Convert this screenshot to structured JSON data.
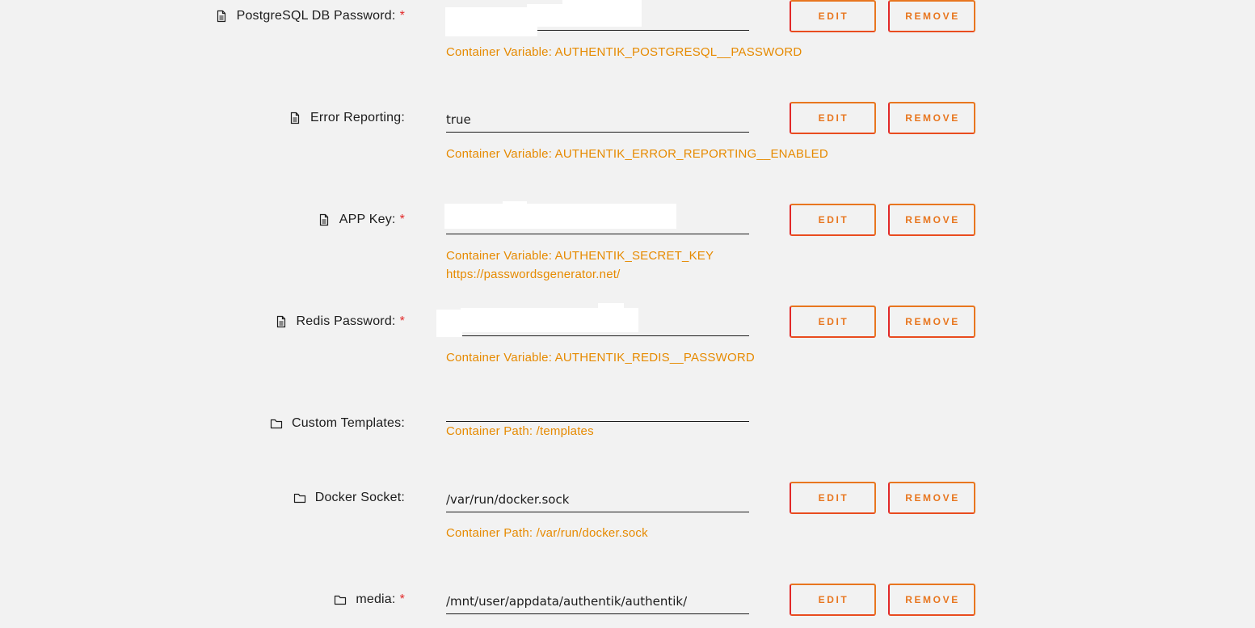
{
  "labels": {
    "edit": "EDIT",
    "remove": "REMOVE",
    "required_mark": "*"
  },
  "colors": {
    "accent_orange": "#e68a00",
    "button_border_red": "#e22828",
    "required_red": "#e22828"
  },
  "settings": [
    {
      "icon": "file-icon",
      "label": "PostgreSQL DB Password:",
      "required": true,
      "value": "",
      "value_masked": true,
      "description": "Container Variable: AUTHENTIK_POSTGRESQL__PASSWORD",
      "has_buttons": true
    },
    {
      "icon": "file-icon",
      "label": "Error Reporting:",
      "required": false,
      "value": "true",
      "description": "Container Variable: AUTHENTIK_ERROR_REPORTING__ENABLED",
      "has_buttons": true
    },
    {
      "icon": "file-icon",
      "label": "APP Key:",
      "required": true,
      "value": "",
      "value_masked": true,
      "description": "Container Variable: AUTHENTIK_SECRET_KEY",
      "description_extra": "https://passwordsgenerator.net/",
      "has_buttons": true
    },
    {
      "icon": "file-icon",
      "label": "Redis Password:",
      "required": true,
      "value": "",
      "value_masked": true,
      "description": "Container Variable: AUTHENTIK_REDIS__PASSWORD",
      "has_buttons": true
    },
    {
      "icon": "folder-icon",
      "label": "Custom Templates:",
      "required": false,
      "value": "",
      "description": "Container Path: /templates",
      "has_buttons": false
    },
    {
      "icon": "folder-icon",
      "label": "Docker Socket:",
      "required": false,
      "value": "/var/run/docker.sock",
      "description": "Container Path: /var/run/docker.sock",
      "has_buttons": true
    },
    {
      "icon": "folder-icon",
      "label": "media:",
      "required": true,
      "value": "/mnt/user/appdata/authentik/authentik/",
      "description": "",
      "has_buttons": true
    }
  ]
}
